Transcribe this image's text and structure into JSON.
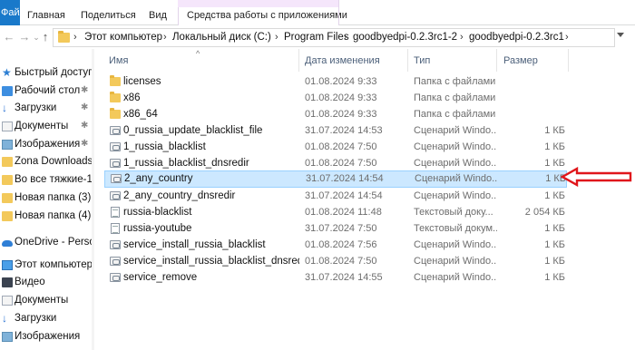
{
  "ribbon": {
    "file_tab": "Файл",
    "home_tab": "Главная",
    "share_tab": "Поделиться",
    "view_tab": "Вид",
    "context_tab": "Средства работы с приложениями"
  },
  "address": {
    "crumbs": [
      "Этот компьютер",
      "Локальный диск (C:)",
      "Program Files",
      "goodbyedpi-0.2.3rc1-2",
      "goodbyedpi-0.2.3rc1"
    ]
  },
  "nav_pane": {
    "items": [
      {
        "label": "Быстрый доступ",
        "icon": "star-icon"
      },
      {
        "label": "Рабочий стол",
        "icon": "desktop-icon",
        "pinned": true
      },
      {
        "label": "Загрузки",
        "icon": "download-icon",
        "pinned": true
      },
      {
        "label": "Документы",
        "icon": "documents-icon",
        "pinned": true
      },
      {
        "label": "Изображения",
        "icon": "pictures-icon",
        "pinned": true
      },
      {
        "label": "Zona Downloads",
        "icon": "folder-icon"
      },
      {
        "label": "Во все тяжкие-1",
        "icon": "folder-icon"
      },
      {
        "label": "Новая папка (3)",
        "icon": "folder-icon"
      },
      {
        "label": "Новая папка (4)",
        "icon": "folder-icon"
      },
      {
        "label": "OneDrive - Personal",
        "icon": "onedrive-icon"
      },
      {
        "label": "Этот компьютер",
        "icon": "computer-icon"
      },
      {
        "label": "Видео",
        "icon": "video-icon"
      },
      {
        "label": "Документы",
        "icon": "documents-icon"
      },
      {
        "label": "Загрузки",
        "icon": "download-icon"
      },
      {
        "label": "Изображения",
        "icon": "pictures-icon"
      }
    ]
  },
  "columns": {
    "name": "Имя",
    "date": "Дата изменения",
    "type": "Тип",
    "size": "Размер"
  },
  "files": [
    {
      "name": "licenses",
      "date": "01.08.2024 9:33",
      "type": "Папка с файлами",
      "size": "",
      "kind": "folder"
    },
    {
      "name": "x86",
      "date": "01.08.2024 9:33",
      "type": "Папка с файлами",
      "size": "",
      "kind": "folder"
    },
    {
      "name": "x86_64",
      "date": "01.08.2024 9:33",
      "type": "Папка с файлами",
      "size": "",
      "kind": "folder"
    },
    {
      "name": "0_russia_update_blacklist_file",
      "date": "31.07.2024 14:53",
      "type": "Сценарий Windo...",
      "size": "1 КБ",
      "kind": "script"
    },
    {
      "name": "1_russia_blacklist",
      "date": "01.08.2024 7:50",
      "type": "Сценарий Windo...",
      "size": "1 КБ",
      "kind": "script"
    },
    {
      "name": "1_russia_blacklist_dnsredir",
      "date": "01.08.2024 7:50",
      "type": "Сценарий Windo...",
      "size": "1 КБ",
      "kind": "script"
    },
    {
      "name": "2_any_country",
      "date": "31.07.2024 14:54",
      "type": "Сценарий Windo...",
      "size": "1 КБ",
      "kind": "script",
      "selected": true
    },
    {
      "name": "2_any_country_dnsredir",
      "date": "31.07.2024 14:54",
      "type": "Сценарий Windo...",
      "size": "1 КБ",
      "kind": "script"
    },
    {
      "name": "russia-blacklist",
      "date": "01.08.2024 11:48",
      "type": "Текстовый доку...",
      "size": "2 054 КБ",
      "kind": "text"
    },
    {
      "name": "russia-youtube",
      "date": "31.07.2024 7:50",
      "type": "Текстовый докум...",
      "size": "1 КБ",
      "kind": "text"
    },
    {
      "name": "service_install_russia_blacklist",
      "date": "01.08.2024 7:56",
      "type": "Сценарий Windo...",
      "size": "1 КБ",
      "kind": "script"
    },
    {
      "name": "service_install_russia_blacklist_dnsredir",
      "date": "01.08.2024 7:50",
      "type": "Сценарий Windo...",
      "size": "1 КБ",
      "kind": "script"
    },
    {
      "name": "service_remove",
      "date": "31.07.2024 14:55",
      "type": "Сценарий Windo...",
      "size": "1 КБ",
      "kind": "script"
    }
  ],
  "colors": {
    "ribbon_file": "#1979ca",
    "selection": "#cce8ff",
    "context_band": "#f5e6fb",
    "annotation_arrow": "#e0161b"
  }
}
